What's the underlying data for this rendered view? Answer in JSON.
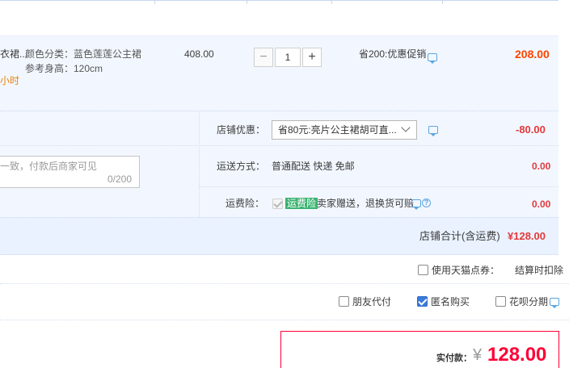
{
  "item": {
    "title_fragment": "衣裙...",
    "ship_time_fragment": "小时",
    "color_label": "颜色分类：蓝色莲莲公主裙",
    "height_label": "参考身高：120cm",
    "unit_price": "408.00",
    "quantity": "1",
    "qty_minus": "−",
    "qty_plus": "+",
    "promo_text": "省200:优惠促销",
    "subtotal": "208.00"
  },
  "shop": {
    "coupon_label": "店铺优惠：",
    "coupon_selected": "省80元:亮片公主裙胡可直...",
    "coupon_amount": "-80.00",
    "message_placeholder": "一致，付款后商家可见",
    "message_count": "0/200",
    "shipping_label": "运送方式：",
    "shipping_value": "普通配送 快递 免邮",
    "shipping_amount": "0.00",
    "insurance_label": "运费险：",
    "insurance_badge": "运费险",
    "insurance_text": "卖家赠送，退换货可赔",
    "insurance_amount": "0.00",
    "help_glyph": "?",
    "total_label": "店铺合计(含运费)",
    "total_amount": "¥128.00"
  },
  "options": {
    "points_label": "使用天猫点券：",
    "points_note": "结算时扣除",
    "friend_pay_label": "朋友代付",
    "anonymous_label": "匿名购买",
    "huabei_label": "花呗分期"
  },
  "payment": {
    "label": "实付款：",
    "yen": "¥",
    "amount": "128.00"
  },
  "colors": {
    "accent_red": "#ff0036",
    "link_blue": "#3b7bdc",
    "row_bg": "#f2f7ff"
  }
}
